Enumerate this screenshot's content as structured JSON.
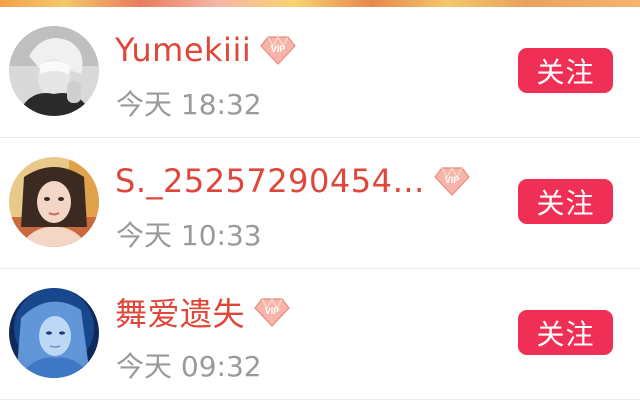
{
  "colors": {
    "username": "#e0463a",
    "time": "#9a9a9a",
    "follow_button_bg": "#ef2f55",
    "follow_button_text": "#ffffff",
    "divider": "#ececec"
  },
  "follow_label": "关注",
  "users": [
    {
      "name": "Yumekiii",
      "time": "今天 18:32",
      "badge": "vip-badge-icon",
      "avatar": "avatar-grayscale-anime"
    },
    {
      "name": "S._25257290454…",
      "time": "今天 10:33",
      "badge": "vip-badge-icon",
      "avatar": "avatar-photo-girl"
    },
    {
      "name": "舞爱遗失",
      "time": "今天 09:32",
      "badge": "vip-badge-icon",
      "avatar": "avatar-blue-fantasy"
    }
  ]
}
